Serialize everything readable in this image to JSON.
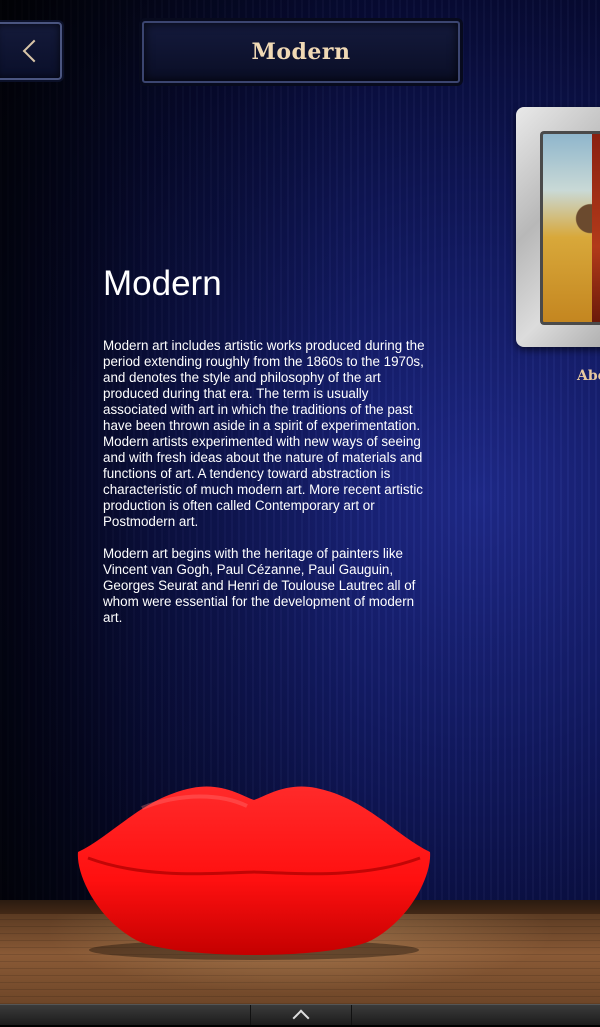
{
  "header": {
    "title": "Modern"
  },
  "article": {
    "heading": "Modern",
    "paragraphs": [
      "Modern art includes artistic works produced during the period extending roughly from the 1860s to the 1970s, and denotes the style and philosophy of the art produced during that era. The term is usually associated with art in which the traditions of the past have been thrown aside in a spirit of experimentation. Modern artists experimented with new ways of seeing and with fresh ideas about the nature of materials and functions of art. A tendency toward abstraction is characteristic of much modern art. More recent artistic production is often called Contemporary art or Postmodern art.",
      "Modern art begins with the heritage of painters like Vincent van Gogh, Paul Cézanne, Paul Gauguin, Georges Seurat and Henri de Toulouse Lautrec all of whom were essential for the development of modern art."
    ]
  },
  "gallery": {
    "next_label": "Abe"
  },
  "icons": {
    "back": "chevron-left-icon",
    "drawer": "chevron-up-icon"
  },
  "colors": {
    "wall": "#0a0f4a",
    "title_text": "#f0d9b5",
    "sofa": "#ff1a1a"
  }
}
